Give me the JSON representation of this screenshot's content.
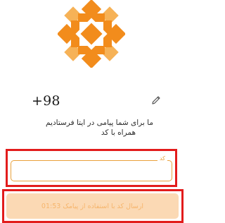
{
  "logo": {
    "icon": "flower-logo-icon",
    "color_primary": "#f28c1c",
    "color_secondary": "#f6b257"
  },
  "phone": {
    "number": "+98",
    "edit_icon": "pencil-icon"
  },
  "message": {
    "line1": "ما برای شما پیامی در ایتا فرستادیم",
    "line2": "همراه با کد"
  },
  "code_field": {
    "label": "کد",
    "value": ""
  },
  "submit": {
    "label": "ارسال کد با استفاده از پیامک 01:53"
  },
  "colors": {
    "accent": "#e9a13b",
    "highlight": "#e21c1c",
    "button_bg": "#fbd9b4",
    "button_text": "#f6b56c"
  }
}
